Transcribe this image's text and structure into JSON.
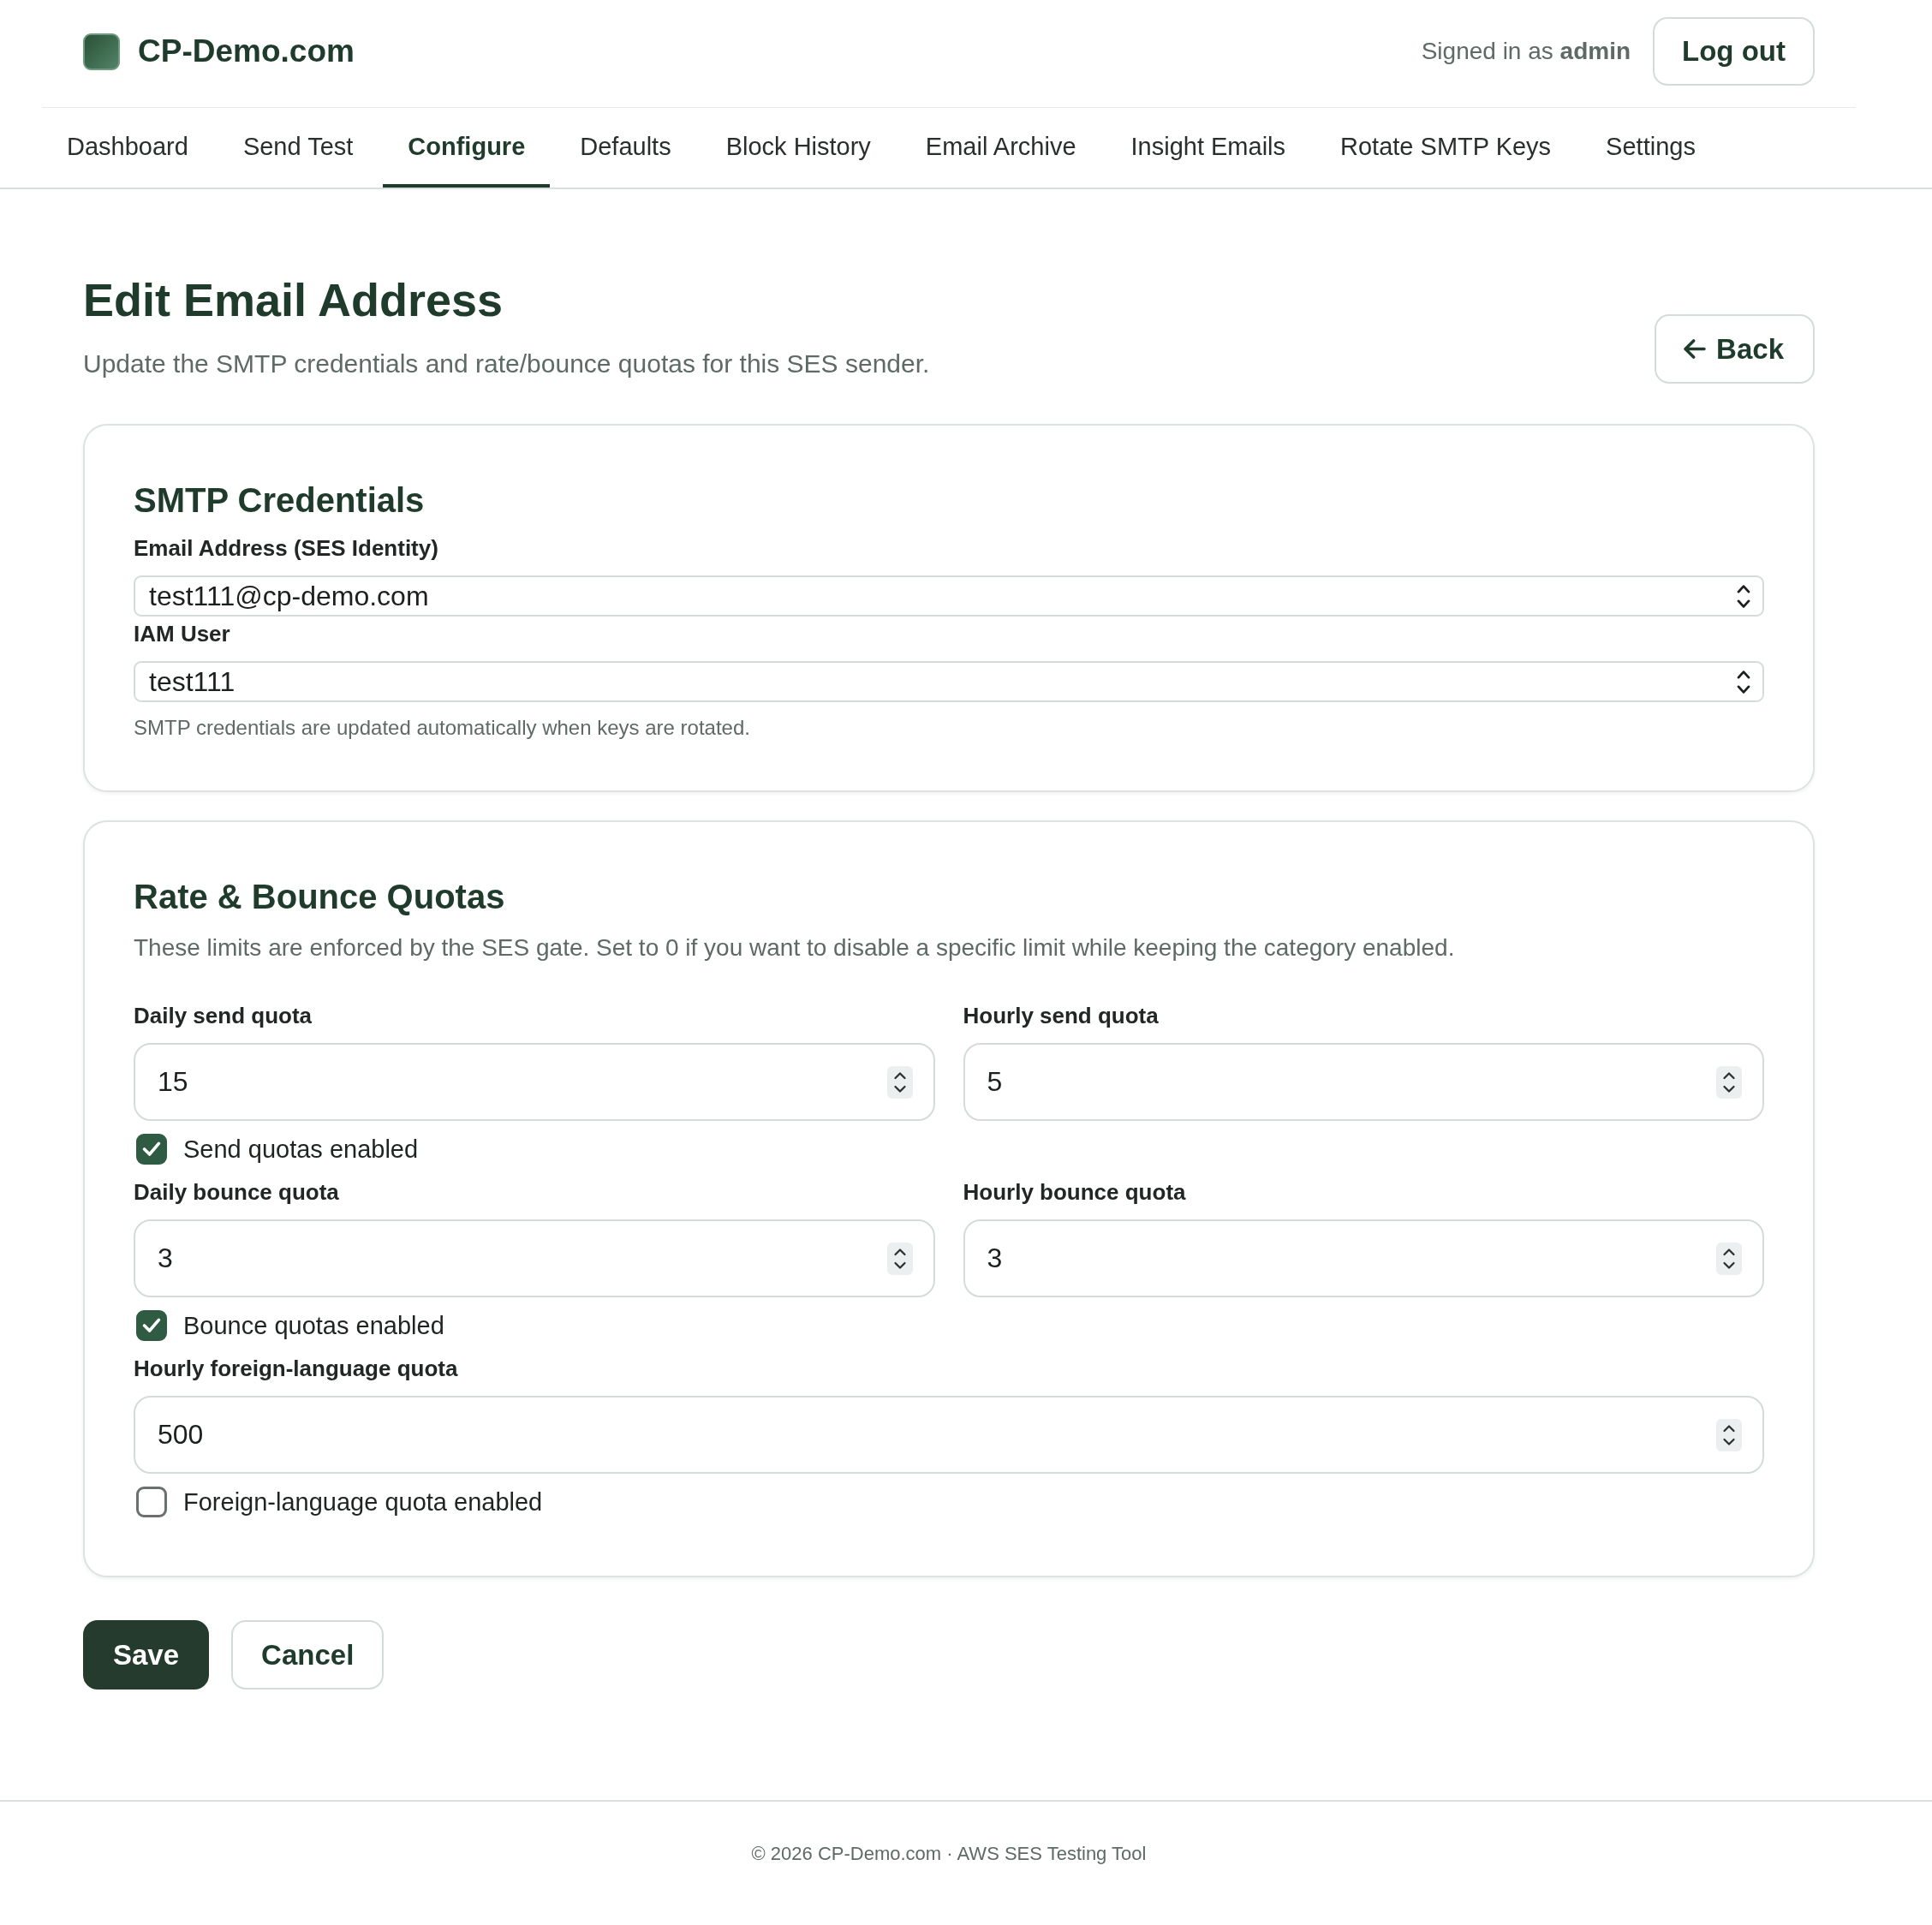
{
  "header": {
    "brand": "CP-Demo.com",
    "signed_in": "Signed in as **admin**",
    "logout_button": "Log out"
  },
  "nav": {
    "tabs": [
      {
        "label": "Dashboard",
        "selected": false
      },
      {
        "label": "Send Test",
        "selected": false
      },
      {
        "label": "Configure",
        "selected": true
      },
      {
        "label": "Defaults",
        "selected": false
      },
      {
        "label": "Block History",
        "selected": false
      },
      {
        "label": "Email Archive",
        "selected": false
      },
      {
        "label": "Insight Emails",
        "selected": false
      },
      {
        "label": "Rotate SMTP Keys",
        "selected": false
      },
      {
        "label": "Settings",
        "selected": false
      }
    ]
  },
  "page": {
    "title": "Edit Email Address",
    "subtitle": "Update the SMTP credentials and rate/bounce quotas for this SES sender.",
    "back_button": "Back"
  },
  "smtp_card": {
    "heading": "SMTP Credentials",
    "fields": [
      {
        "label": "Email Address (SES Identity)",
        "value": "test111@cp-demo.com"
      },
      {
        "label": "IAM User",
        "value": "test111"
      }
    ],
    "help": "SMTP credentials are updated automatically when keys are rotated."
  },
  "quotas_card": {
    "heading": "Rate & Bounce Quotas",
    "description": "These limits are enforced by the SES gate. Set to 0 if you want to disable a specific limit while keeping the category enabled.",
    "groups": [
      {
        "fields": [
          {
            "label": "Daily send quota",
            "value": "15"
          },
          {
            "label": "Hourly send quota",
            "value": "5"
          }
        ],
        "toggle": {
          "label": "Send quotas enabled",
          "checked": true
        }
      },
      {
        "fields": [
          {
            "label": "Daily bounce quota",
            "value": "3"
          },
          {
            "label": "Hourly bounce quota",
            "value": "3"
          }
        ],
        "toggle": {
          "label": "Bounce quotas enabled",
          "checked": true
        }
      },
      {
        "fields": [
          {
            "label": "Hourly foreign-language quota",
            "value": "500"
          }
        ],
        "toggle": {
          "label": "Foreign-language quota enabled",
          "checked": false
        }
      }
    ]
  },
  "actions": [
    {
      "label": "Save",
      "kind": "primary"
    },
    {
      "label": "Cancel",
      "kind": "secondary"
    }
  ],
  "footer": {
    "text": "© 2026 CP-Demo.com · AWS SES Testing Tool"
  }
}
